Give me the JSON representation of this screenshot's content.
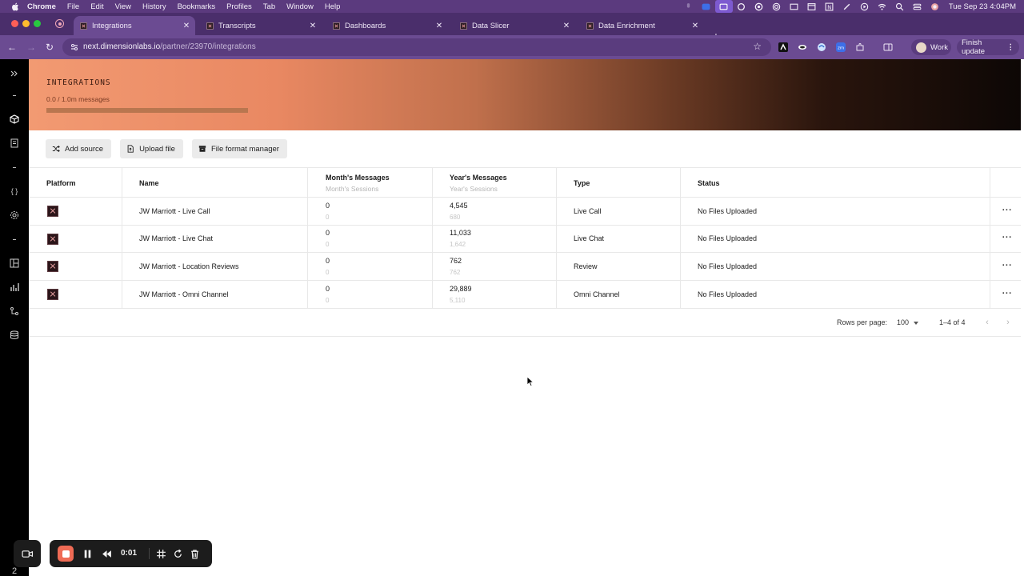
{
  "menubar": {
    "app_name": "Chrome",
    "items": [
      "File",
      "Edit",
      "View",
      "History",
      "Bookmarks",
      "Profiles",
      "Tab",
      "Window",
      "Help"
    ],
    "clock": "Tue Sep 23  4:04PM"
  },
  "tabs": [
    {
      "title": "Integrations",
      "active": true
    },
    {
      "title": "Transcripts",
      "active": false
    },
    {
      "title": "Dashboards",
      "active": false
    },
    {
      "title": "Data Slicer",
      "active": false
    },
    {
      "title": "Data Enrichment",
      "active": false
    }
  ],
  "toolbar": {
    "url_host": "next.dimensionlabs.io",
    "url_path": "/partner/23970/integrations",
    "profile_label": "Work",
    "update_label": "Finish update"
  },
  "banner": {
    "title": "INTEGRATIONS",
    "usage_text": "0.0 / 1.0m messages",
    "usage_fraction": 0
  },
  "actions": {
    "add_source": "Add source",
    "upload_file": "Upload file",
    "file_format_manager": "File format manager"
  },
  "table": {
    "headers": {
      "platform": "Platform",
      "name": "Name",
      "month_messages": "Month's Messages",
      "month_sessions": "Month's Sessions",
      "year_messages": "Year's Messages",
      "year_sessions": "Year's Sessions",
      "type": "Type",
      "status": "Status"
    },
    "rows": [
      {
        "name": "JW Marriott - Live Call",
        "month_messages": "0",
        "month_sessions": "0",
        "year_messages": "4,545",
        "year_sessions": "680",
        "type": "Live Call",
        "status": "No Files Uploaded"
      },
      {
        "name": "JW Marriott - Live Chat",
        "month_messages": "0",
        "month_sessions": "0",
        "year_messages": "11,033",
        "year_sessions": "1,642",
        "type": "Live Chat",
        "status": "No Files Uploaded"
      },
      {
        "name": "JW Marriott - Location Reviews",
        "month_messages": "0",
        "month_sessions": "0",
        "year_messages": "762",
        "year_sessions": "762",
        "type": "Review",
        "status": "No Files Uploaded"
      },
      {
        "name": "JW Marriott - Omni Channel",
        "month_messages": "0",
        "month_sessions": "0",
        "year_messages": "29,889",
        "year_sessions": "5,110",
        "type": "Omni Channel",
        "status": "No Files Uploaded"
      }
    ]
  },
  "pagination": {
    "rows_per_page_label": "Rows per page:",
    "rows_per_page_value": "100",
    "range": "1–4 of 4"
  },
  "sidebar": {
    "count": "2"
  },
  "recorder": {
    "time": "0:01"
  },
  "colors": {
    "menubar": "#5b3a7e",
    "tabstrip": "#4a2e6b",
    "toolbar": "#6b4b92",
    "sidebar": "#000000",
    "banner_start": "#f29a72",
    "banner_end": "#0d0705",
    "record": "#ef6b55"
  },
  "icons": [
    "apple-icon",
    "search-icon",
    "wifi-icon",
    "star-icon",
    "shuffle-icon",
    "file-upload-icon",
    "archive-icon",
    "more-icon",
    "chevron-left-icon",
    "chevron-right-icon",
    "camera-icon",
    "pause-icon",
    "rewind-icon",
    "grid-icon",
    "restart-icon",
    "trash-icon"
  ]
}
